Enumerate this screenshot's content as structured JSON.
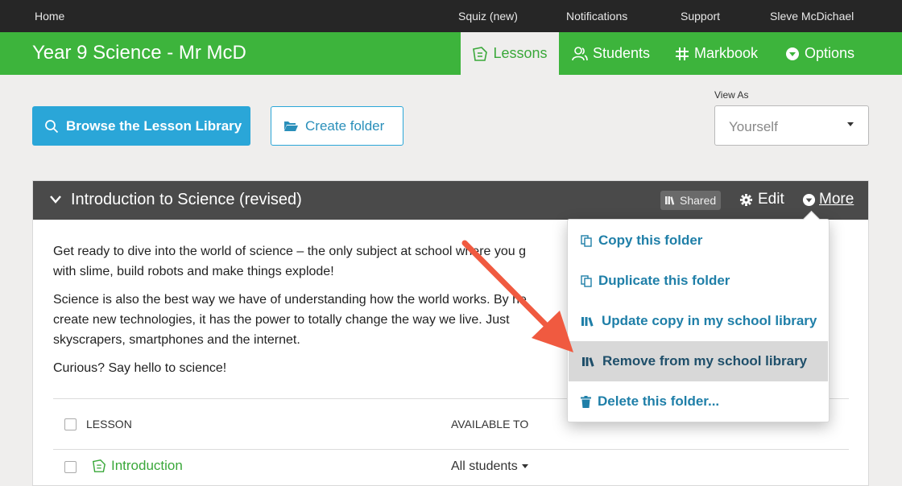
{
  "topnav": {
    "home": "Home",
    "squiz": "Squiz (new)",
    "notifications": "Notifications",
    "support": "Support",
    "user": "Sleve McDichael"
  },
  "header": {
    "class_title": "Year 9 Science - Mr McD",
    "tabs": {
      "lessons": "Lessons",
      "students": "Students",
      "markbook": "Markbook",
      "options": "Options"
    },
    "brand_color": "#3db43c"
  },
  "toolbar": {
    "browse_label": "Browse the Lesson Library",
    "create_folder_label": "Create folder",
    "view_as_label": "View As",
    "view_as_value": "Yourself"
  },
  "folder": {
    "title": "Introduction to Science (revised)",
    "shared_label": "Shared",
    "edit_label": "Edit",
    "more_label": "More",
    "description": {
      "p1_line1": "Get ready to dive into the world of science – the only subject at school where you g",
      "p1_line2": "with slime, build robots and make things explode!",
      "p2_line1": "Science is also the best way we have of understanding how the world works. By he",
      "p2_line2": "create new technologies, it has the power to totally change the way we live. Just",
      "p2_line3": "skyscrapers, smartphones and the internet.",
      "p3": "Curious? Say hello to science!"
    },
    "table": {
      "col_lesson": "LESSON",
      "col_available": "AVAILABLE TO",
      "rows": [
        {
          "name": "Introduction",
          "available": "All students"
        }
      ]
    }
  },
  "more_menu": {
    "items": [
      {
        "label": "Copy this folder",
        "icon": "copy-icon"
      },
      {
        "label": "Duplicate this folder",
        "icon": "copy-icon"
      },
      {
        "label": "Update copy in my school library",
        "icon": "library-icon"
      },
      {
        "label": "Remove from my school library",
        "icon": "library-icon",
        "highlighted": true
      },
      {
        "label": "Delete this folder...",
        "icon": "trash-icon"
      }
    ]
  },
  "annotation_arrow_color": "#f05a40"
}
